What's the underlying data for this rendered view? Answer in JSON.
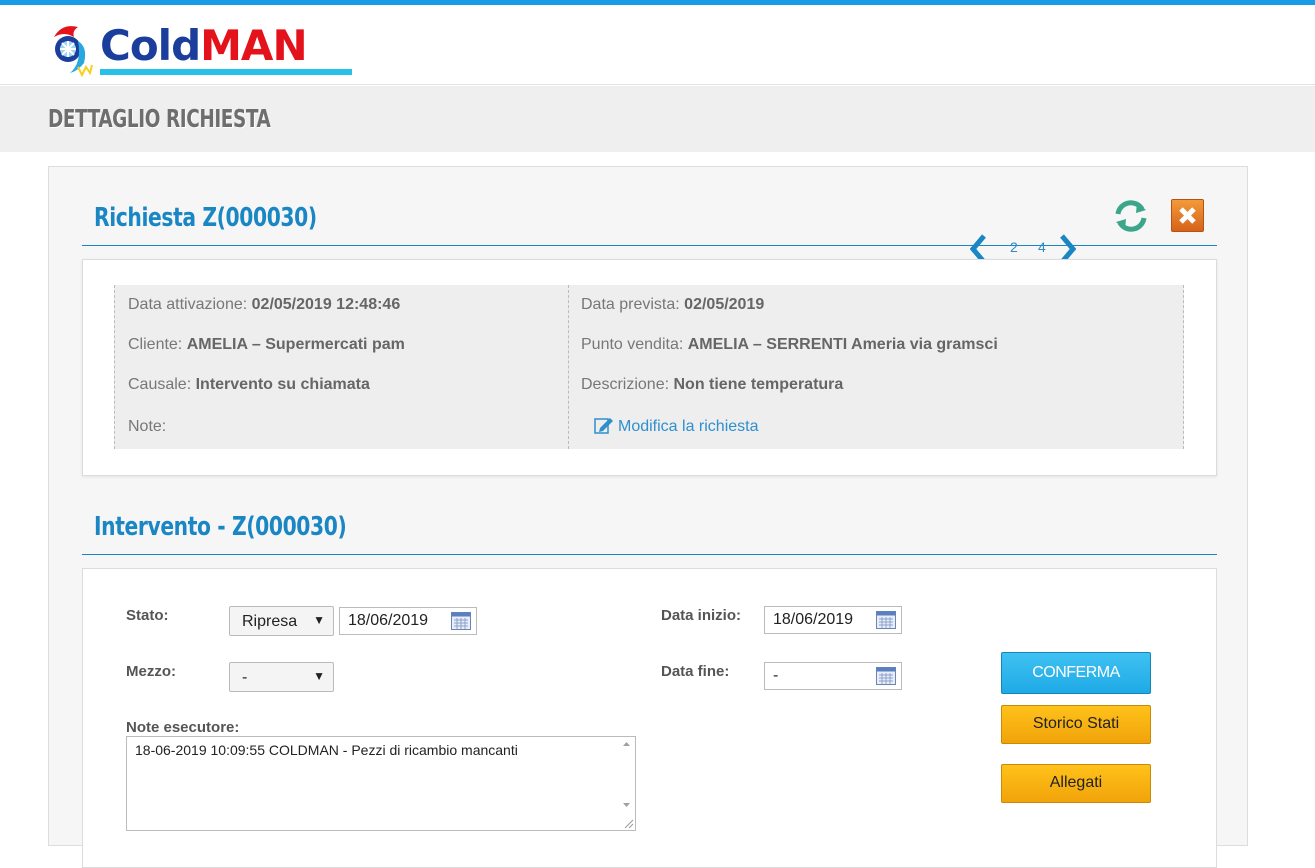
{
  "brand": {
    "part1": "Cold",
    "part2": "MAN"
  },
  "page_title": "DETTAGLIO RICHIESTA",
  "request": {
    "title": "Richiesta Z(000030)",
    "nav": {
      "prev_num": "2",
      "next_num": "4"
    },
    "fields": {
      "data_attivazione_label": "Data attivazione:",
      "data_attivazione_value": "02/05/2019 12:48:46",
      "cliente_label": "Cliente:",
      "cliente_value": "AMELIA – Supermercati pam",
      "causale_label": "Causale:",
      "causale_value": "Intervento su chiamata",
      "note_label": "Note:",
      "data_prevista_label": "Data prevista:",
      "data_prevista_value": "02/05/2019",
      "punto_vendita_label": "Punto vendita:",
      "punto_vendita_value": "AMELIA – SERRENTI Ameria via gramsci",
      "descrizione_label": "Descrizione:",
      "descrizione_value": "Non tiene temperatura"
    },
    "edit_link": "Modifica la richiesta"
  },
  "intervention": {
    "title": "Intervento - Z(000030)",
    "stato_label": "Stato:",
    "stato_value": "Ripresa",
    "stato_date": "18/06/2019",
    "mezzo_label": "Mezzo:",
    "mezzo_value": "-",
    "data_inizio_label": "Data inizio:",
    "data_inizio_value": "18/06/2019",
    "data_fine_label": "Data fine:",
    "data_fine_value": "-",
    "note_label": "Note esecutore:",
    "note_value": "18-06-2019 10:09:55 COLDMAN - Pezzi di ricambio mancanti",
    "buttons": {
      "conferma": "CONFERMA",
      "storico": "Storico Stati",
      "allegati": "Allegati"
    }
  },
  "colors": {
    "accent": "#1a86c4",
    "topbar": "#1a9be6",
    "confirm": "#1faae6",
    "secondary": "#f1a30a",
    "close": "#d5631a"
  },
  "icons": [
    "logo-icon",
    "chevron-left-icon",
    "chevron-right-icon",
    "refresh-icon",
    "close-icon",
    "edit-icon",
    "calendar-icon",
    "dropdown-arrow-icon"
  ]
}
